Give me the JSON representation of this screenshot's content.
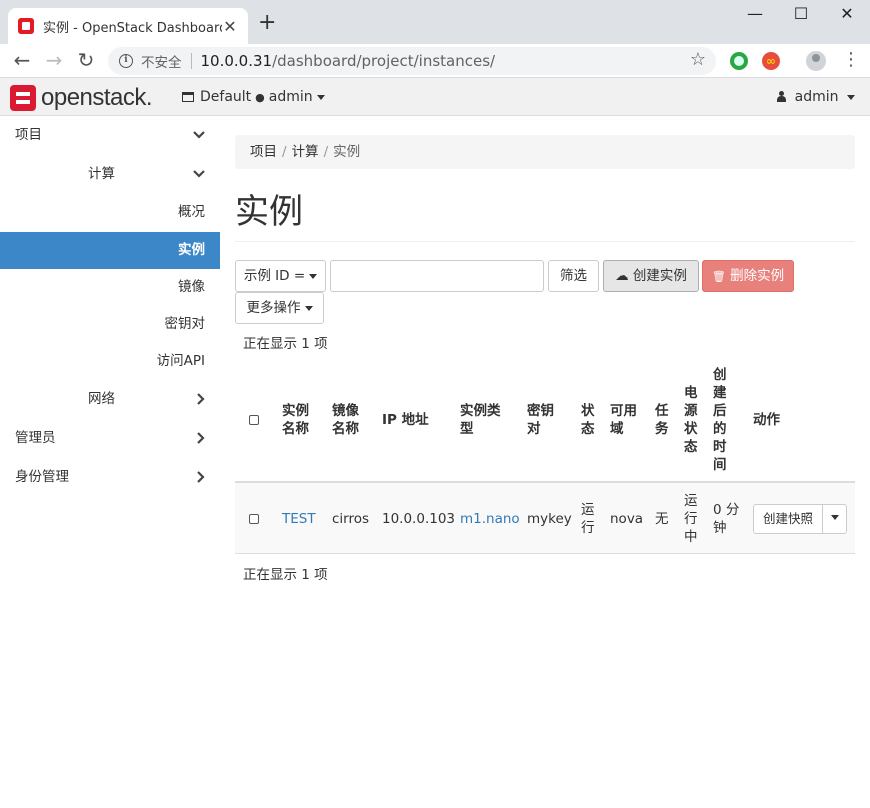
{
  "browser": {
    "tab_title": "实例 - OpenStack Dashboard",
    "tab_close": "✕",
    "new_tab": "+",
    "window_controls": {
      "minimize": "—",
      "maximize": "☐",
      "close": "✕"
    },
    "nav": {
      "back": "←",
      "forward": "→",
      "reload": "↻"
    },
    "security_label": "不安全",
    "url_host": "10.0.0.31",
    "url_path": "/dashboard/project/instances/",
    "star": "☆",
    "ext2_label": "∞",
    "menu": "⋮"
  },
  "header": {
    "logo_text": "openstack.",
    "project_domain": "Default",
    "project_dot": "●",
    "project_name": "admin",
    "user_icon": "👤",
    "user_name": "admin"
  },
  "sidebar": {
    "items": [
      {
        "label": "项目",
        "chevron": "⌄"
      },
      {
        "label": "计算",
        "chevron": "⌄"
      },
      {
        "label": "概况"
      },
      {
        "label": "实例"
      },
      {
        "label": "镜像"
      },
      {
        "label": "密钥对"
      },
      {
        "label": "访问API"
      },
      {
        "label": "网络",
        "chevron": "›"
      },
      {
        "label": "管理员",
        "chevron": "›"
      },
      {
        "label": "身份管理",
        "chevron": "›"
      }
    ]
  },
  "breadcrumb": {
    "items": [
      "项目",
      "计算",
      "实例"
    ],
    "divider": "/"
  },
  "page_title": "实例",
  "actions": {
    "filter_field": "示例 ID =",
    "filter_value": "",
    "filter_button": "筛选",
    "create_button": "创建实例",
    "delete_button": "删除实例",
    "more_button": "更多操作",
    "create_icon": "☁",
    "delete_icon": "🗑"
  },
  "count_text": "正在显示 1 项",
  "table": {
    "headers": [
      [
        "实例",
        "名称"
      ],
      [
        "镜像",
        "名称"
      ],
      [
        "IP 地址"
      ],
      [
        "实例类",
        "型"
      ],
      [
        "密钥",
        "对"
      ],
      [
        "状",
        "态"
      ],
      [
        "可用",
        "域"
      ],
      [
        "任",
        "务"
      ],
      [
        "电",
        "源",
        "状",
        "态"
      ],
      [
        "创",
        "建",
        "后",
        "的",
        "时",
        "间"
      ],
      [
        "动作"
      ]
    ],
    "rows": [
      {
        "name": "TEST",
        "image": "cirros",
        "ip": "10.0.0.103",
        "flavor": "m1.nano",
        "keypair": "mykey",
        "status": [
          "运",
          "行"
        ],
        "zone": "nova",
        "task": "无",
        "power": [
          "运",
          "行",
          "中"
        ],
        "age": [
          "0 分",
          "钟"
        ],
        "action": "创建快照"
      }
    ]
  }
}
